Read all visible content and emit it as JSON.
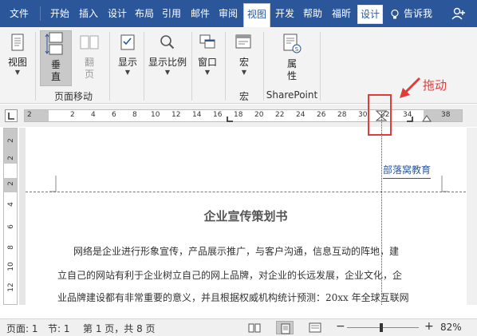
{
  "tabs": [
    "文件",
    "开始",
    "插入",
    "设计",
    "布局",
    "引用",
    "邮件",
    "审阅",
    "视图",
    "开发",
    "帮助",
    "福昕",
    "设计"
  ],
  "active_tab_index": 8,
  "tell_me": "告诉我",
  "ribbon": {
    "view_label": "视图",
    "vertical_label": "垂\n直",
    "flip_label": "翻\n页",
    "page_move_group": "页面移动",
    "show_label": "显示",
    "zoom_label": "显示比例",
    "window_label": "窗口",
    "macro_label": "宏",
    "macro_group": "宏",
    "property_label": "属\n性",
    "sharepoint_group": "SharePoint"
  },
  "ruler": {
    "ticks": [
      "2",
      "2",
      "4",
      "6",
      "8",
      "10",
      "12",
      "14",
      "16",
      "18",
      "20",
      "22",
      "24",
      "26",
      "28",
      "30",
      "32",
      "34",
      "38"
    ]
  },
  "vruler": {
    "ticks": [
      "2",
      "2",
      "2",
      "4",
      "6",
      "8",
      "10",
      "12"
    ]
  },
  "document": {
    "header": "部落窝教育",
    "title": "企业宣传策划书",
    "lines": [
      "网络是企业进行形象宣传，产品展示推广，与客户沟通，信息互动的阵地，建",
      "立自己的网站有利于企业树立自己的网上品牌，对企业的长远发展，企业文化，企",
      "业品牌建设都有非常重要的意义，并且根据权威机构统计预测：20xx 年全球互联网"
    ]
  },
  "annotation": {
    "drag_label": "拖动",
    "color": "#e23b3b"
  },
  "status": {
    "page": "页面: 1",
    "section": "节: 1",
    "pages": "第 1 页，共 8 页",
    "zoom_minus": "−",
    "zoom_plus": "+",
    "zoom": "82%"
  },
  "colors": {
    "accent": "#2b579a",
    "ribbon_bg": "#f3f3f3"
  }
}
